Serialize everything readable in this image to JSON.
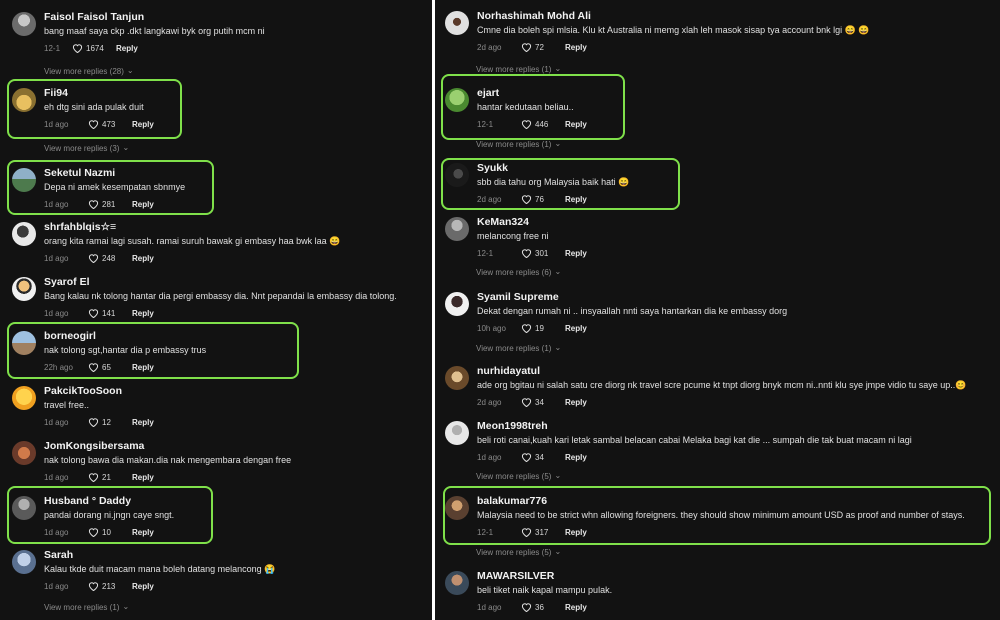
{
  "left": {
    "comments": [
      {
        "user": "Faisol Faisol Tanjun",
        "text": "bang maaf saya ckp .dkt langkawi byk org putih mcm ni",
        "date": "12-1",
        "likes": "1674",
        "reply": "Reply",
        "avatar_color": "#6b6b6b"
      },
      {
        "user": "Fii94",
        "text": "eh dtg sini ada pulak duit",
        "date": "1d ago",
        "likes": "473",
        "reply": "Reply",
        "avatar_color": "#c9a53a"
      },
      {
        "user": "Seketul Nazmi",
        "text": "Depa ni amek kesempatan sbnmye",
        "date": "1d ago",
        "likes": "281",
        "reply": "Reply",
        "avatar_color": "#5a7d5a"
      },
      {
        "user": "shrfahblqis☆≡",
        "text": "orang kita ramai lagi susah. ramai suruh bawak gi embasy haa bwk laa 😄",
        "date": "1d ago",
        "likes": "248",
        "reply": "Reply",
        "avatar_color": "#d8d8d8"
      },
      {
        "user": "Syarof El",
        "text": "Bang kalau nk tolong hantar dia pergi embassy dia. Nnt pepandai la embassy dia tolong.",
        "date": "1d ago",
        "likes": "141",
        "reply": "Reply",
        "avatar_color": "#e9e9e9"
      },
      {
        "user": "borneogirl",
        "text": "nak tolong sgt,hantar dia p embassy trus",
        "date": "22h ago",
        "likes": "65",
        "reply": "Reply",
        "avatar_color": "#8aa3b8"
      },
      {
        "user": "PakcikTooSoon",
        "text": "travel free..",
        "date": "1d ago",
        "likes": "12",
        "reply": "Reply",
        "avatar_color": "#f0c24a"
      },
      {
        "user": "JomKongsibersama",
        "text": "nak tolong bawa dia makan.dia nak mengembara dengan free",
        "date": "1d ago",
        "likes": "21",
        "reply": "Reply",
        "avatar_color": "#9a5c3a"
      },
      {
        "user": "Husband ° Daddy",
        "text": "pandai dorang ni.jngn caye sngt.",
        "date": "1d ago",
        "likes": "10",
        "reply": "Reply",
        "avatar_color": "#707070"
      },
      {
        "user": "Sarah",
        "text": "Kalau tkde duit macam mana boleh datang melancong 😭",
        "date": "1d ago",
        "likes": "213",
        "reply": "Reply",
        "avatar_color": "#8aa0c0"
      }
    ],
    "more_replies": [
      "View more replies (28)",
      "View more replies (3)",
      "View more replies (1)"
    ]
  },
  "right": {
    "comments": [
      {
        "user": "Norhashimah Mohd Ali",
        "text": "Cmne dia boleh spi mlsia. Klu kt Australia ni memg xlah leh masok sisap tya account bnk lgi 😄 😄",
        "date": "2d ago",
        "likes": "72",
        "reply": "Reply",
        "avatar_color": "#b8b8b8"
      },
      {
        "user": "ejart",
        "text": "hantar kedutaan beliau..",
        "date": "12-1",
        "likes": "446",
        "reply": "Reply",
        "avatar_color": "#6aa84f"
      },
      {
        "user": "Syukk",
        "text": "sbb dia tahu org Malaysia baik hati 😄",
        "date": "2d ago",
        "likes": "76",
        "reply": "Reply",
        "avatar_color": "#2a2a2a"
      },
      {
        "user": "KeMan324",
        "text": "melancong free ni",
        "date": "12-1",
        "likes": "301",
        "reply": "Reply",
        "avatar_color": "#7a7a7a"
      },
      {
        "user": "Syamil Supreme",
        "text": "Dekat dengan rumah ni .. insyaallah nnti saya hantarkan dia ke embassy dorg",
        "date": "10h ago",
        "likes": "19",
        "reply": "Reply",
        "avatar_color": "#e6e6e6"
      },
      {
        "user": "nurhidayatul",
        "text": "ade org bgitau ni salah satu cre diorg nk travel scre pcume kt tnpt diorg bnyk mcm ni..nnti klu sye jmpe vidio tu saye up..😊",
        "date": "2d ago",
        "likes": "34",
        "reply": "Reply",
        "avatar_color": "#c8a070"
      },
      {
        "user": "Meon1998treh",
        "text": "beli roti canai,kuah kari letak sambal belacan cabai Melaka bagi kat die ... sumpah die tak buat macam ni lagi",
        "date": "1d ago",
        "likes": "34",
        "reply": "Reply",
        "avatar_color": "#dcdcdc"
      },
      {
        "user": "balakumar776",
        "text": "Malaysia need to be strict whn allowing foreigners. they should show minimum amount USD as proof and number of stays.",
        "date": "12-1",
        "likes": "317",
        "reply": "Reply",
        "avatar_color": "#8a6a4a"
      },
      {
        "user": "MAWARSILVER",
        "text": "beli tiket naik kapal mampu pulak.",
        "date": "1d ago",
        "likes": "36",
        "reply": "Reply",
        "avatar_color": "#5a6a7a"
      }
    ],
    "more_replies": [
      "View more replies (1)",
      "View more replies (1)",
      "View more replies (6)",
      "View more replies (1)",
      "View more replies (5)",
      "View more replies (5)"
    ]
  },
  "colors": {
    "highlight": "#7fe04a",
    "background": "#121212"
  }
}
